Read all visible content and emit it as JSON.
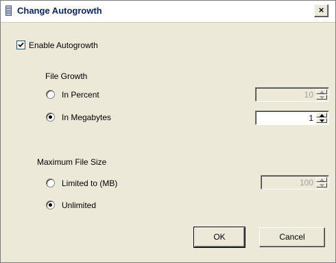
{
  "window": {
    "title": "Change Autogrowth",
    "close_glyph": "×"
  },
  "enable_autogrowth": {
    "label": "Enable Autogrowth",
    "checked": true
  },
  "file_growth": {
    "heading": "File Growth",
    "in_percent": {
      "label": "In Percent",
      "selected": false,
      "value": "10",
      "enabled": false
    },
    "in_megabytes": {
      "label": "In Megabytes",
      "selected": true,
      "value": "1",
      "enabled": true
    }
  },
  "max_file_size": {
    "heading": "Maximum File Size",
    "limited": {
      "label": "Limited to (MB)",
      "selected": false,
      "value": "100",
      "enabled": false
    },
    "unlimited": {
      "label": "Unlimited",
      "selected": true
    }
  },
  "buttons": {
    "ok": "OK",
    "cancel": "Cancel"
  },
  "icons": {
    "title": "database-file-icon",
    "close": "close-icon",
    "checkmark": "checkmark-icon",
    "spin_up": "spin-up-arrow-icon",
    "spin_down": "spin-down-arrow-icon"
  }
}
